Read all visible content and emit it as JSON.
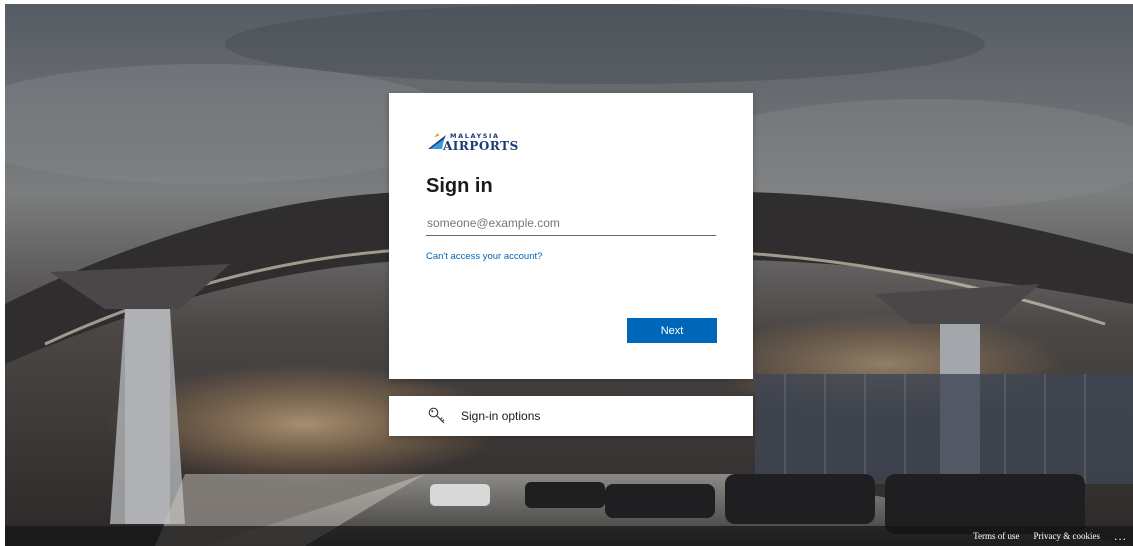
{
  "brand": {
    "line1": "MALAYSIA",
    "line2": "AIRPORTS"
  },
  "signin": {
    "title": "Sign in",
    "email_placeholder": "someone@example.com",
    "email_value": "",
    "cant_access": "Can't access your account?",
    "next_label": "Next"
  },
  "options": {
    "label": "Sign-in options",
    "icon": "key-icon"
  },
  "footer": {
    "terms": "Terms of use",
    "privacy": "Privacy & cookies",
    "more": "..."
  },
  "colors": {
    "accent": "#0067b8",
    "brand_navy": "#1b3a7a"
  }
}
